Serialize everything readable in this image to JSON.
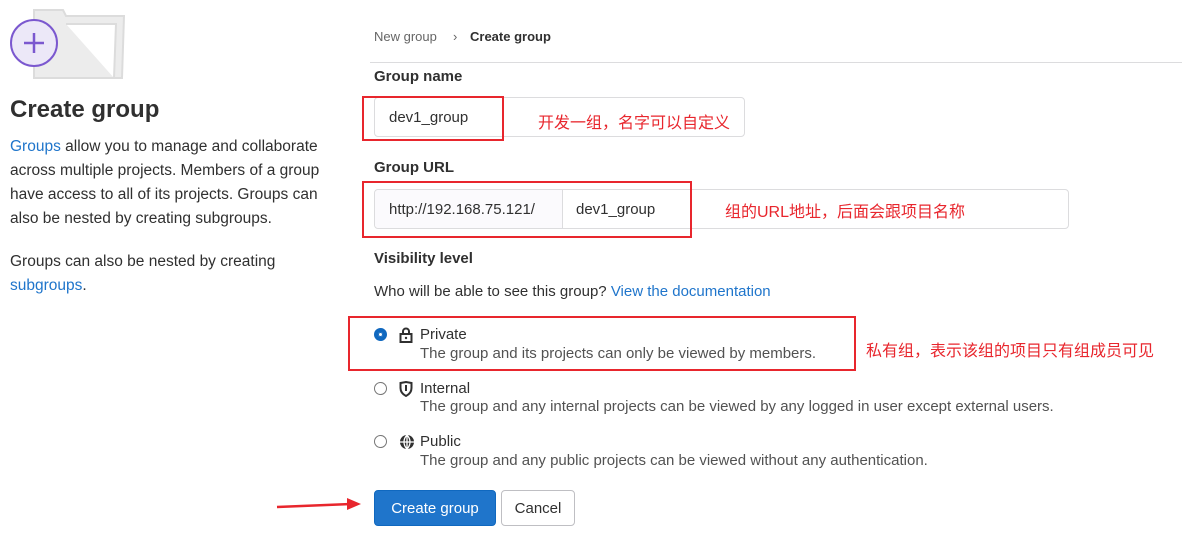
{
  "sidebar": {
    "title": "Create group",
    "desc_link": "Groups",
    "desc_text": " allow you to manage and collaborate across multiple projects. Members of a group have access to all of its projects. Groups can also be nested by creating subgroups.",
    "nested_text": "Groups can also be nested by creating ",
    "nested_link": "subgroups",
    "nested_end": "."
  },
  "breadcrumb": {
    "items": [
      "New group",
      "Create group"
    ],
    "separator": "›"
  },
  "form": {
    "group_name_label": "Group name",
    "group_name_value": "dev1_group",
    "group_url_label": "Group URL",
    "url_prefix": "http://192.168.75.121/",
    "url_path": "dev1_group",
    "visibility_label": "Visibility level",
    "visibility_help": "Who will be able to see this group? ",
    "visibility_link": "View the documentation",
    "options": [
      {
        "title": "Private",
        "desc": "The group and its projects can only be viewed by members.",
        "selected": true,
        "icon": "lock-icon"
      },
      {
        "title": "Internal",
        "desc": "The group and any internal projects can be viewed by any logged in user except external users.",
        "selected": false,
        "icon": "shield-icon"
      },
      {
        "title": "Public",
        "desc": "The group and any public projects can be viewed without any authentication.",
        "selected": false,
        "icon": "globe-icon"
      }
    ],
    "create_label": "Create group",
    "cancel_label": "Cancel"
  },
  "annotations": {
    "name": "开发一组，名字可以自定义",
    "url": "组的URL地址，后面会跟项目名称",
    "private": "私有组，表示该组的项目只有组成员可见"
  },
  "colors": {
    "primary": "#1f75cb",
    "annotation": "#e8262d",
    "illustration": "#7b58cf"
  }
}
